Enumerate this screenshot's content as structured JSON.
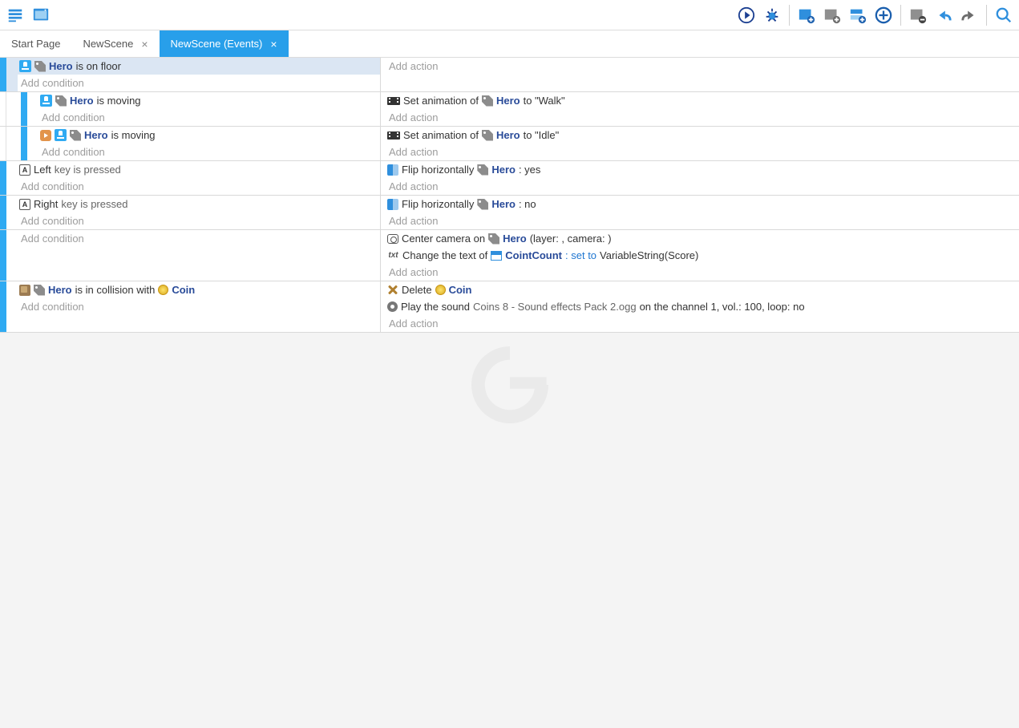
{
  "toolbar": {
    "left": [
      "project-manager",
      "scene-editor"
    ],
    "right": [
      "play",
      "debug",
      "sep",
      "add-event",
      "add-subevent",
      "add-comment",
      "add-new",
      "sep",
      "remove",
      "undo",
      "redo",
      "sep",
      "search"
    ]
  },
  "tabs": [
    {
      "label": "Start Page",
      "closable": false,
      "active": false
    },
    {
      "label": "NewScene",
      "closable": true,
      "active": false
    },
    {
      "label": "NewScene (Events)",
      "closable": true,
      "active": true
    }
  ],
  "add_condition": "Add condition",
  "add_action": "Add action",
  "events": [
    {
      "depth": 0,
      "sel": true,
      "conditions": [
        {
          "type": "plat",
          "parts": [
            "obj:Hero",
            "txt: is on floor"
          ]
        }
      ],
      "actions": []
    },
    {
      "depth": 1,
      "sel": false,
      "conditions": [
        {
          "type": "plat",
          "parts": [
            "obj:Hero",
            "txt: is moving"
          ]
        }
      ],
      "actions": [
        {
          "type": "anim",
          "parts": [
            "txt:Set animation of ",
            "tag",
            "obj: Hero",
            "txt: to \"Walk\""
          ]
        }
      ]
    },
    {
      "depth": 1,
      "sel": false,
      "invert": true,
      "conditions": [
        {
          "type": "plat",
          "parts": [
            "obj:Hero",
            "txt: is moving"
          ]
        }
      ],
      "actions": [
        {
          "type": "anim",
          "parts": [
            "txt:Set animation of ",
            "tag",
            "obj: Hero",
            "txt: to \"Idle\""
          ]
        }
      ]
    },
    {
      "depth": 0,
      "sel": false,
      "conditions": [
        {
          "type": "key",
          "parts": [
            "txt:Left",
            "g: key is pressed"
          ]
        }
      ],
      "actions": [
        {
          "type": "flip",
          "parts": [
            "txt:Flip horizontally ",
            "tag",
            "obj: Hero",
            "txt: : yes"
          ]
        }
      ]
    },
    {
      "depth": 0,
      "sel": false,
      "conditions": [
        {
          "type": "key",
          "parts": [
            "txt:Right",
            "g: key is pressed"
          ]
        }
      ],
      "actions": [
        {
          "type": "flip",
          "parts": [
            "txt:Flip horizontally ",
            "tag",
            "obj: Hero",
            "txt: : no"
          ]
        }
      ]
    },
    {
      "depth": 0,
      "sel": false,
      "conditions": [],
      "actions": [
        {
          "type": "cam",
          "parts": [
            "txt:Center camera on ",
            "tag",
            "obj: Hero",
            "txt: (layer: , camera: )"
          ]
        },
        {
          "type": "txt",
          "parts": [
            "txt:Change the text of ",
            "tb",
            "obj: CointCount",
            "kw:: set to ",
            "txt: VariableString(Score)"
          ]
        }
      ]
    },
    {
      "depth": 0,
      "sel": false,
      "conditions": [
        {
          "type": "coll",
          "parts": [
            "obj:Hero",
            "txt: is in collision with ",
            "coin",
            "obj:Coin"
          ]
        }
      ],
      "actions": [
        {
          "type": "del",
          "parts": [
            "txt:Delete ",
            "coin",
            "obj:Coin"
          ]
        },
        {
          "type": "snd",
          "parts": [
            "txt:Play the sound ",
            "g:Coins 8 - Sound effects Pack 2.ogg",
            "txt: on the channel 1, vol.: 100, loop: no"
          ]
        }
      ]
    }
  ]
}
